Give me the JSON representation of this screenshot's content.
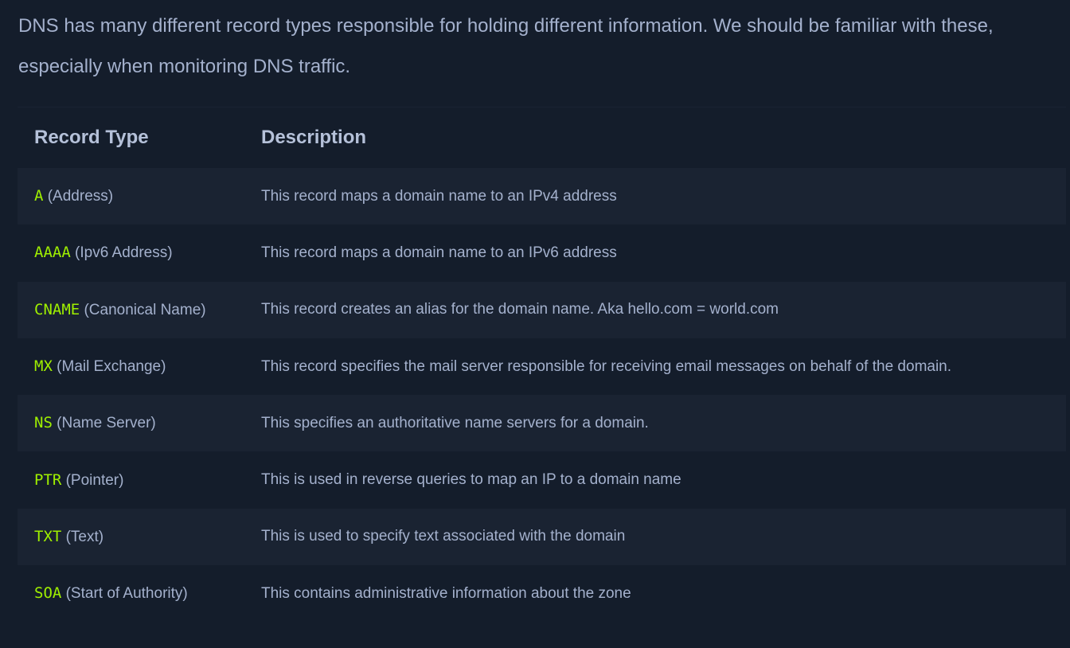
{
  "intro": "DNS has many different record types responsible for holding different information. We should be familiar with these, especially when monitoring DNS traffic.",
  "table": {
    "headers": {
      "record_type": "Record Type",
      "description": "Description"
    },
    "rows": [
      {
        "code": "A",
        "name": "(Address)",
        "description": "This record maps a domain name to an IPv4 address"
      },
      {
        "code": "AAAA",
        "name": "(Ipv6 Address)",
        "description": "This record maps a domain name to an IPv6 address"
      },
      {
        "code": "CNAME",
        "name": "(Canonical Name)",
        "description": "This record creates an alias for the domain name. Aka hello.com = world.com"
      },
      {
        "code": "MX",
        "name": "(Mail Exchange)",
        "description": "This record specifies the mail server responsible for receiving email messages on behalf of the domain."
      },
      {
        "code": "NS",
        "name": "(Name Server)",
        "description": "This specifies an authoritative name servers for a domain."
      },
      {
        "code": "PTR",
        "name": "(Pointer)",
        "description": "This is used in reverse queries to map an IP to a domain name"
      },
      {
        "code": "TXT",
        "name": "(Text)",
        "description": "This is used to specify text associated with the domain"
      },
      {
        "code": "SOA",
        "name": "(Start of Authority)",
        "description": "This contains administrative information about the zone"
      }
    ]
  },
  "colors": {
    "background": "#141d2b",
    "row_alt": "#1a2332",
    "code": "#9fef00",
    "text": "#a4b1cd"
  }
}
